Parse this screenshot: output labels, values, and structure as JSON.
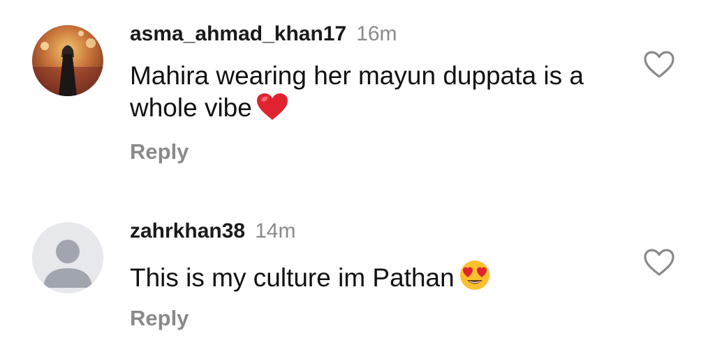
{
  "comments": [
    {
      "username": "asma_ahmad_khan17",
      "time": "16m",
      "text": "Mahira wearing her mayun duppata is a whole vibe",
      "emoji": "red-heart-icon",
      "reply_label": "Reply",
      "avatar": "profile-photo"
    },
    {
      "username": "zahrkhan38",
      "time": "14m",
      "text": "This is my culture im Pathan",
      "emoji": "heart-eyes-emoji-icon",
      "reply_label": "Reply",
      "avatar": "default-person-icon"
    }
  ],
  "colors": {
    "secondary_text": "#8a8a8a",
    "primary_text": "#111111",
    "heart_red": "#e0242f",
    "emoji_yellow": "#fbc02d",
    "default_avatar_bg": "#e6e8ec",
    "default_avatar_fg": "#a1a5ae"
  }
}
